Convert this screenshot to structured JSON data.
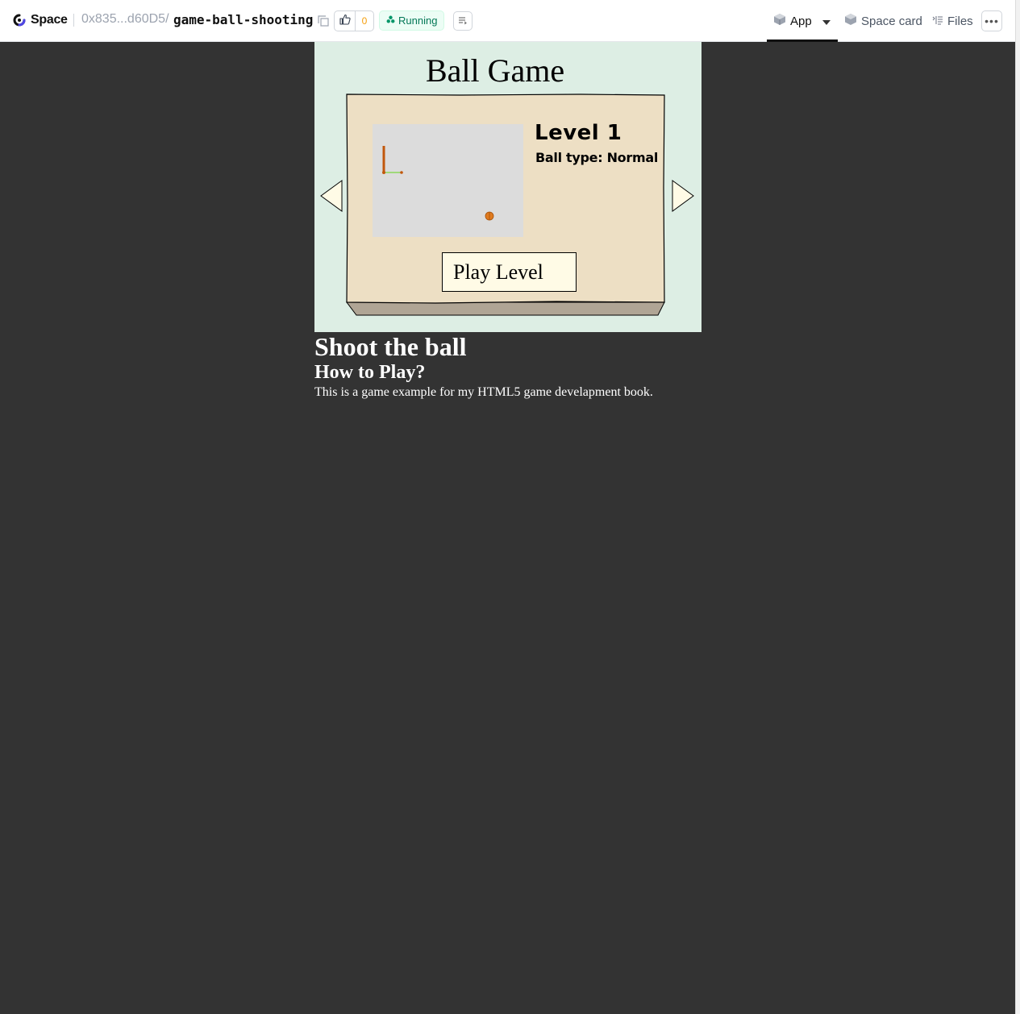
{
  "header": {
    "brand": "Space",
    "owner": "0x835...d60D5/",
    "repo": "game-ball-shooting",
    "like_count": "0",
    "status": "Running",
    "tabs": {
      "app": "App",
      "space_card": "Space card",
      "files": "Files"
    }
  },
  "game": {
    "title": "Ball Game",
    "level_title": "Level 1",
    "ball_type": "Ball type: Normal",
    "play_button": "Play Level"
  },
  "description": {
    "heading": "Shoot the ball",
    "subheading": "How to Play?",
    "text": "This is a game example for my HTML5 game develapment book."
  },
  "colors": {
    "page_background": "#333333",
    "game_background": "#ddeee4",
    "board": "#eddfc4",
    "board_base": "#b0a595",
    "preview": "#dcdcdc",
    "running_text": "#047857",
    "ball": "#e07b1f"
  }
}
